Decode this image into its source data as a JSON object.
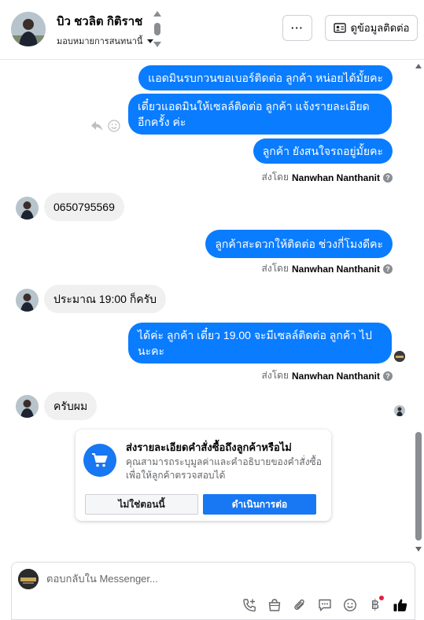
{
  "header": {
    "contact_name": "บิว ชวลิต กิติราช",
    "assignee": "มอบหมายการสนทนานี้",
    "more_label": "···",
    "contact_info_label": "ดูข้อมูลติดต่อ"
  },
  "messages": [
    {
      "direction": "out",
      "text": "แอดมินรบกวนขอเบอร์ติดต่อ ลูกค้า หน่อยได้มั้ยคะ"
    },
    {
      "direction": "out",
      "text": "เดี๋ยวแอดมินให้เซลล์ติดต่อ ลูกค้า แจ้งรายละเอียดอีกครั้ง ค่ะ"
    },
    {
      "direction": "out",
      "text": "ลูกค้า ยังสนใจรถอยู่มั้ยคะ"
    },
    {
      "direction": "in",
      "text": "0650795569"
    },
    {
      "direction": "out",
      "text": "ลูกค้าสะดวกให้ติดต่อ ช่วงกี่โมงดีคะ"
    },
    {
      "direction": "in",
      "text": "ประมาณ 19:00 ก็ครับ"
    },
    {
      "direction": "out",
      "text": "ได้ค่ะ  ลูกค้า เดี๋ยว 19.00 จะมีเซลล์ติดต่อ ลูกค้า ไปนะคะ"
    },
    {
      "direction": "in",
      "text": "ครับผม"
    }
  ],
  "sent_by": {
    "prefix": "ส่งโดย",
    "name": "Nanwhan Nanthanit",
    "help_glyph": "?"
  },
  "order_card": {
    "title": "ส่งรายละเอียดคำสั่งซื้อถึงลูกค้าหรือไม่",
    "description": "คุณสามารถระบุมูลค่าและคำอธิบายของคำสั่งซื้อเพื่อให้ลูกค้าตรวจสอบได้",
    "decline_label": "ไม่ใช่ตอนนี้",
    "confirm_label": "ดำเนินการต่อ"
  },
  "composer": {
    "placeholder": "ตอบกลับใน Messenger...",
    "value": "",
    "currency_glyph": "฿"
  },
  "colors": {
    "outgoing_bubble": "#0a7cff",
    "incoming_bubble": "#f0f0f0",
    "accent": "#1877f2",
    "notification_dot": "#e41e3f"
  },
  "icons": [
    "more-icon",
    "contact-card-icon",
    "reply-icon",
    "react-icon",
    "help-icon",
    "cart-icon",
    "call-add-icon",
    "shop-bag-icon",
    "attach-icon",
    "saved-reply-icon",
    "emoji-icon",
    "baht-icon",
    "thumbs-up-icon"
  ]
}
